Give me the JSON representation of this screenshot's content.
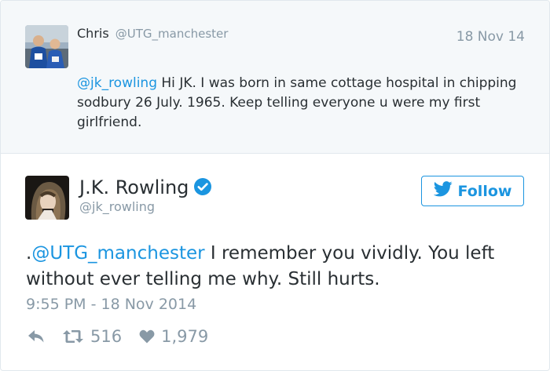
{
  "parent_tweet": {
    "display_name": "Chris",
    "handle": "@UTG_manchester",
    "date": "18 Nov 14",
    "text_mention": "@jk_rowling",
    "text_body": " Hi JK. I was born in same cottage hospital in chipping sodbury 26 July. 1965. Keep telling everyone u were my first girlfriend."
  },
  "main_tweet": {
    "display_name": "J.K. Rowling",
    "handle": "@jk_rowling",
    "follow_label": "Follow",
    "text_prefix": ".",
    "text_mention": "@UTG_manchester",
    "text_body": " I remember you vividly. You left without ever telling me why. Still hurts.",
    "timestamp": "9:55 PM - 18 Nov 2014",
    "retweet_count": "516",
    "like_count": "1,979"
  },
  "colors": {
    "accent": "#1b95e0",
    "muted": "#8899a6",
    "text": "#292f33",
    "parent_background": "#f5f8fa"
  },
  "icons": [
    "verified-icon",
    "twitter-bird-icon",
    "reply-icon",
    "retweet-icon",
    "heart-icon"
  ]
}
